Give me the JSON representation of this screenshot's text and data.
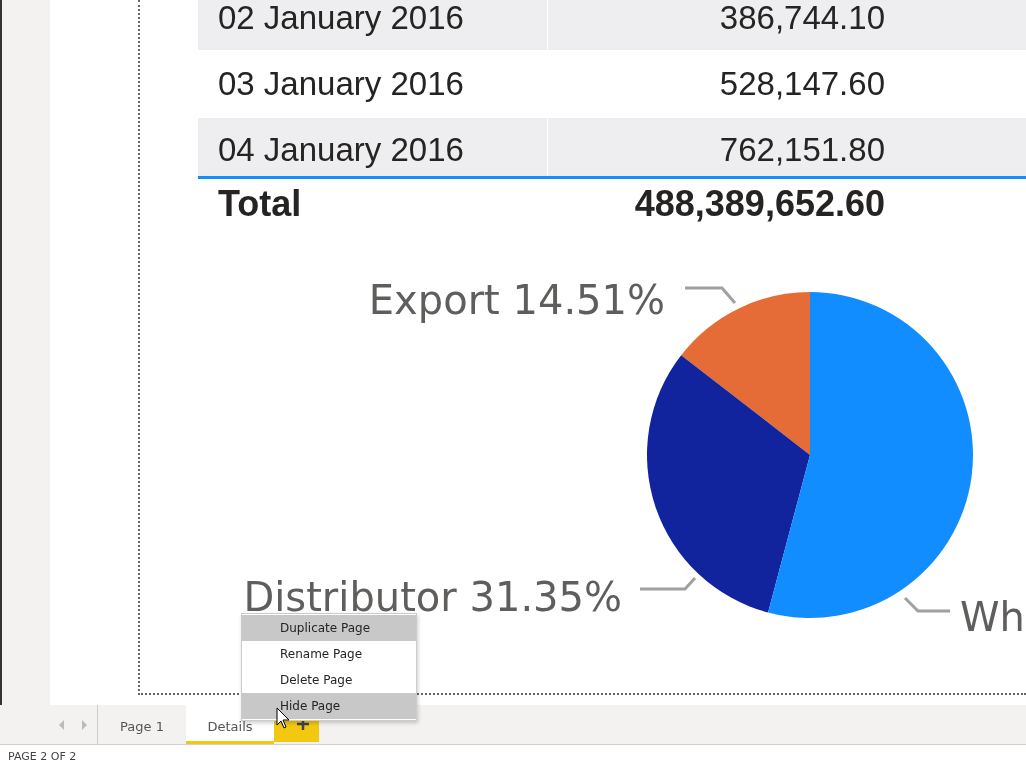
{
  "table": {
    "rows": [
      {
        "date": "02 January 2016",
        "value": "386,744.10",
        "shaded": true
      },
      {
        "date": "03 January 2016",
        "value": "528,147.60",
        "shaded": false
      },
      {
        "date": "04 January 2016",
        "value": "762,151.80",
        "shaded": true
      }
    ],
    "total": {
      "label": "Total",
      "value": "488,389,652.60"
    }
  },
  "chart": {
    "chart_data": {
      "type": "pie",
      "categories": [
        "Export",
        "Distributor",
        "Wh"
      ],
      "values": [
        14.51,
        31.35,
        54.14
      ],
      "value_labels": [
        "14.51%",
        "31.35%",
        null
      ]
    },
    "slices": [
      {
        "color": "#e66c37"
      },
      {
        "color": "#12239e"
      },
      {
        "color": "#118dff"
      }
    ]
  },
  "context_menu": {
    "items": [
      {
        "label": "Duplicate Page",
        "highlighted": true
      },
      {
        "label": "Rename Page",
        "highlighted": false
      },
      {
        "label": "Delete Page",
        "highlighted": false
      },
      {
        "label": "Hide Page",
        "highlighted": true
      }
    ]
  },
  "tabs": [
    {
      "label": "Page 1",
      "selected": false
    },
    {
      "label": "Details",
      "selected": true
    }
  ],
  "status_bar": "PAGE 2 OF 2"
}
